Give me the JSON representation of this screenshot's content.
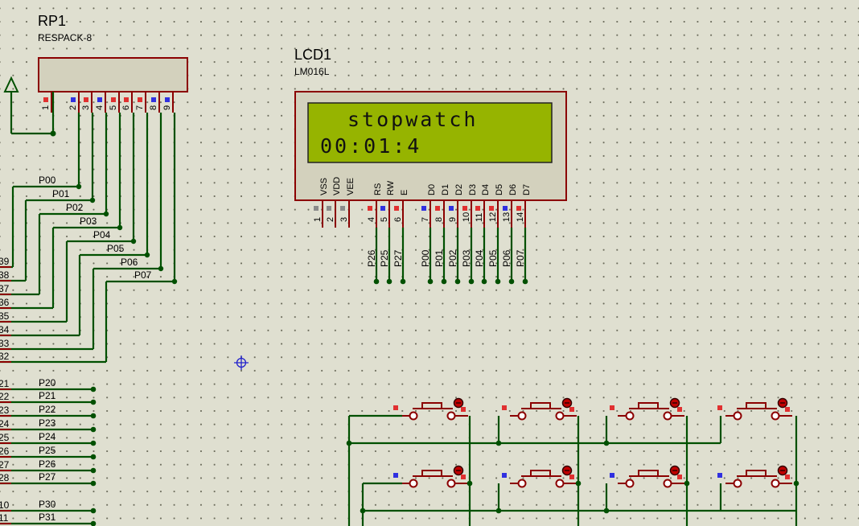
{
  "rp1": {
    "ref": "RP1",
    "value": "RESPACK-8",
    "pins": [
      "1",
      "2",
      "3",
      "4",
      "5",
      "6",
      "7",
      "8",
      "9"
    ]
  },
  "lcd": {
    "ref": "LCD1",
    "value": "LM016L",
    "line1": "stopwatch",
    "line2": "00:01:4",
    "pin_names": [
      "VSS",
      "VDD",
      "VEE",
      "RS",
      "RW",
      "E",
      "D0",
      "D1",
      "D2",
      "D3",
      "D4",
      "D5",
      "D6",
      "D7"
    ],
    "pin_numbers": [
      "1",
      "2",
      "3",
      "4",
      "5",
      "6",
      "7",
      "8",
      "9",
      "10",
      "11",
      "12",
      "13",
      "14"
    ],
    "ctrl_nets": [
      "P26",
      "P25",
      "P27"
    ],
    "data_nets": [
      "P00",
      "P01",
      "P02",
      "P03",
      "P04",
      "P05",
      "P06",
      "P07"
    ]
  },
  "port0_nets": [
    "P00",
    "P01",
    "P02",
    "P03",
    "P04",
    "P05",
    "P06",
    "P07"
  ],
  "port0_pins": [
    "39",
    "38",
    "37",
    "36",
    "35",
    "34",
    "33",
    "32"
  ],
  "port2_nets": [
    "P20",
    "P21",
    "P22",
    "P23",
    "P24",
    "P25",
    "P26",
    "P27"
  ],
  "port2_pins": [
    "21",
    "22",
    "23",
    "24",
    "25",
    "26",
    "27",
    "28"
  ],
  "port3_nets": [
    "P30",
    "P31"
  ],
  "port3_pins": [
    "10",
    "11"
  ]
}
